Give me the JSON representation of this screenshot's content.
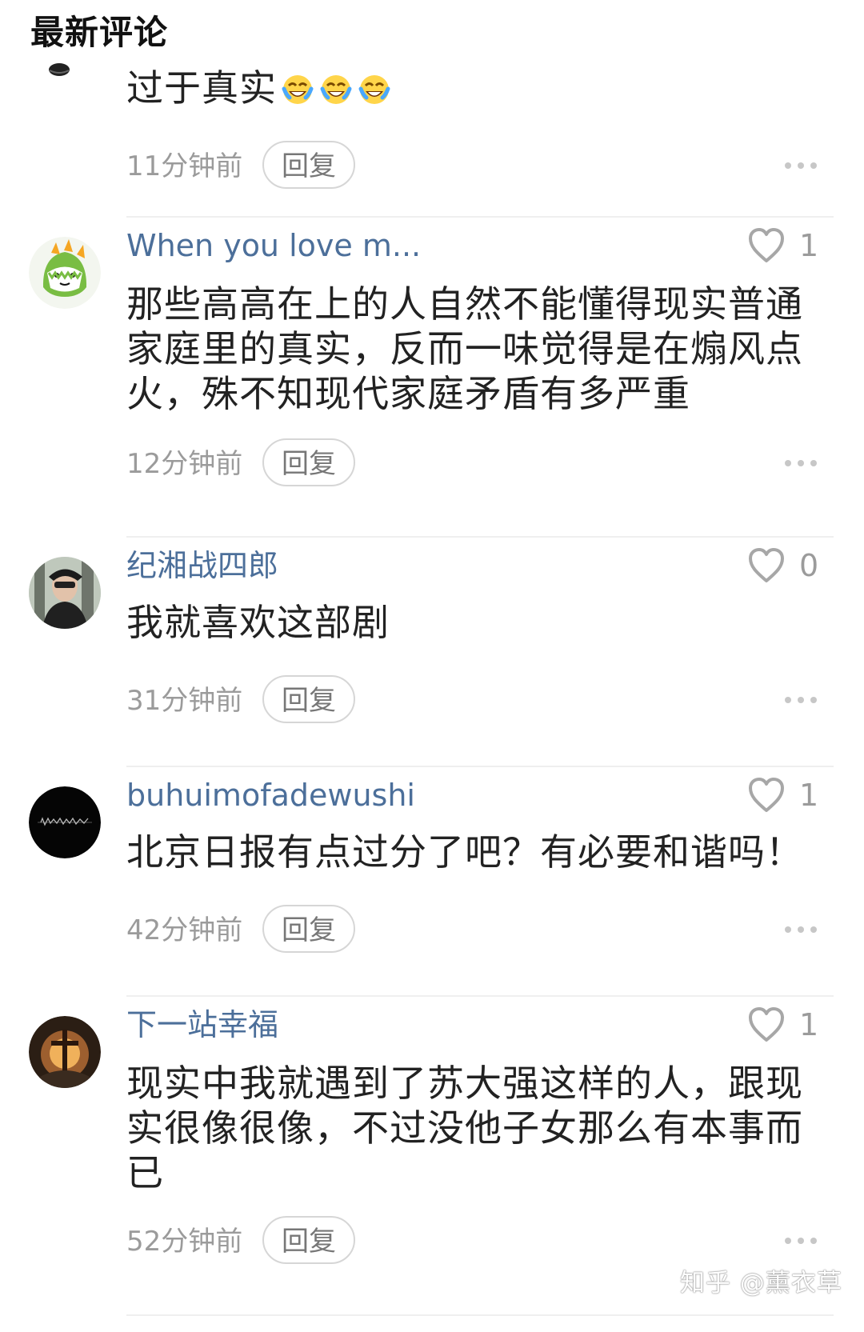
{
  "section": {
    "title": "最新评论"
  },
  "comments": [
    {
      "username": "",
      "likes": "",
      "text": "过于真实",
      "emoji": [
        "crying-laughing-emoji",
        "crying-laughing-emoji",
        "crying-laughing-emoji"
      ],
      "time": "11分钟前",
      "reply": "回复"
    },
    {
      "username": "When you love m...",
      "likes": "1",
      "text": "那些高高在上的人自然不能懂得现实普通家庭里的真实，反而一味觉得是在煽风点火，殊不知现代家庭矛盾有多严重",
      "time": "12分钟前",
      "reply": "回复"
    },
    {
      "username": "纪湘战四郎",
      "likes": "0",
      "text": "我就喜欢这部剧",
      "time": "31分钟前",
      "reply": "回复"
    },
    {
      "username": "buhuimofadewushi",
      "likes": "1",
      "text": "北京日报有点过分了吧？有必要和谐吗！",
      "time": "42分钟前",
      "reply": "回复"
    },
    {
      "username": "下一站幸福",
      "likes": "1",
      "text": "现实中我就遇到了苏大强这样的人，跟现实很像很像，不过没他子女那么有本事而已",
      "time": "52分钟前",
      "reply": "回复"
    }
  ],
  "watermark": {
    "text": "知乎 @薰衣草"
  },
  "icons": {
    "heart": "heart-outline-icon",
    "more": "more-dots-icon"
  },
  "colors": {
    "username": "#4c6f9a",
    "text": "#222222",
    "muted": "#9b9b9b",
    "border": "#d6d6d6"
  }
}
